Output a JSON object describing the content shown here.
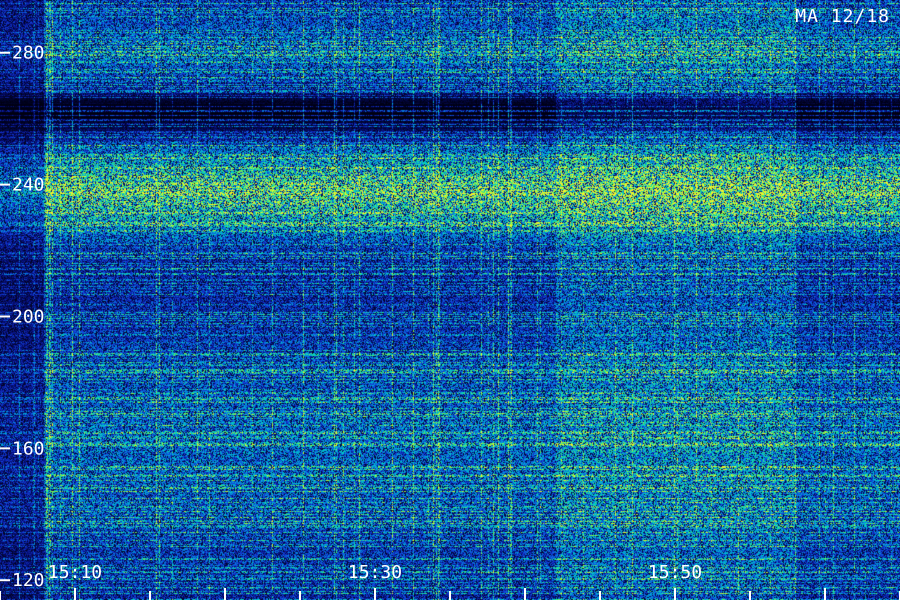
{
  "station_label": "MA 12/18",
  "colors": {
    "background": "#000010",
    "low": "#0a1a9a",
    "mid": "#00b8c8",
    "high": "#80f040",
    "peak": "#f0f020",
    "axis": "#ffffff"
  },
  "chart_data": {
    "type": "heatmap",
    "title": "",
    "xlabel": "",
    "ylabel": "",
    "x_ticks": [
      "15:10",
      "15:30",
      "15:50"
    ],
    "x_tick_minutes": [
      10,
      30,
      50
    ],
    "x_range_minutes": [
      5,
      65
    ],
    "y_ticks": [
      120,
      160,
      200,
      240,
      280
    ],
    "ylim": [
      114,
      296
    ],
    "intensity_profile": {
      "description_bands": [
        {
          "y_center": 238,
          "y_width": 14,
          "level": "high"
        },
        {
          "y_center": 280,
          "y_width": 20,
          "level": "medium"
        },
        {
          "y_center": 160,
          "y_width": 40,
          "level": "medium"
        }
      ],
      "quiet_band": {
        "y_center": 262,
        "y_width": 8
      },
      "onset_minute": 8,
      "enhanced_interval_minutes": [
        42,
        58
      ]
    },
    "grid": false,
    "legend": "none"
  }
}
